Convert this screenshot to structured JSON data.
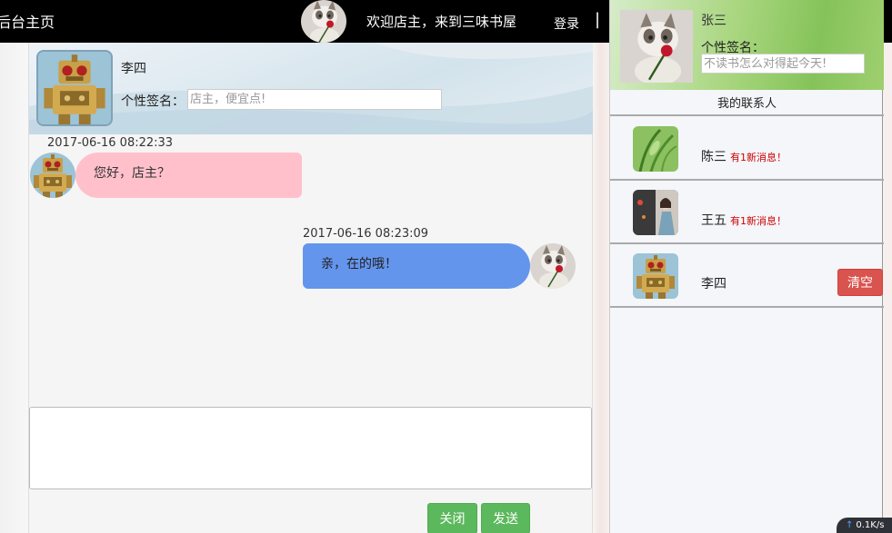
{
  "topbar": {
    "brand": "后台主页",
    "welcome": "欢迎店主，来到三味书屋",
    "login": "登录",
    "separator": "|"
  },
  "chat": {
    "peer_name": "李四",
    "signature_label": "个性签名：",
    "signature_placeholder": "店主，便宜点!",
    "messages": [
      {
        "time": "2017-06-16 08:22:33",
        "text": "您好，店主？",
        "side": "left"
      },
      {
        "time": "2017-06-16 08:23:09",
        "text": "亲，在的哦！",
        "side": "right"
      }
    ],
    "compose_placeholder": "",
    "close_label": "关闭",
    "send_label": "发送"
  },
  "me": {
    "name": "张三",
    "signature_label": "个性签名：",
    "signature_placeholder": "不读书怎么对得起今天!"
  },
  "contacts": {
    "title": "我的联系人",
    "items": [
      {
        "name": "陈三",
        "badge": "有1新消息！"
      },
      {
        "name": "王五",
        "badge": "有1新消息！"
      },
      {
        "name": "李四",
        "badge": ""
      }
    ],
    "clear_label": "清空"
  },
  "speed_widget": {
    "value": "0.1K/s"
  },
  "colors": {
    "left_bubble": "#ffc0cb",
    "right_bubble": "#6495ed",
    "button_green": "#5cb85c",
    "button_red": "#d9534f",
    "badge_red": "#cc0000"
  }
}
